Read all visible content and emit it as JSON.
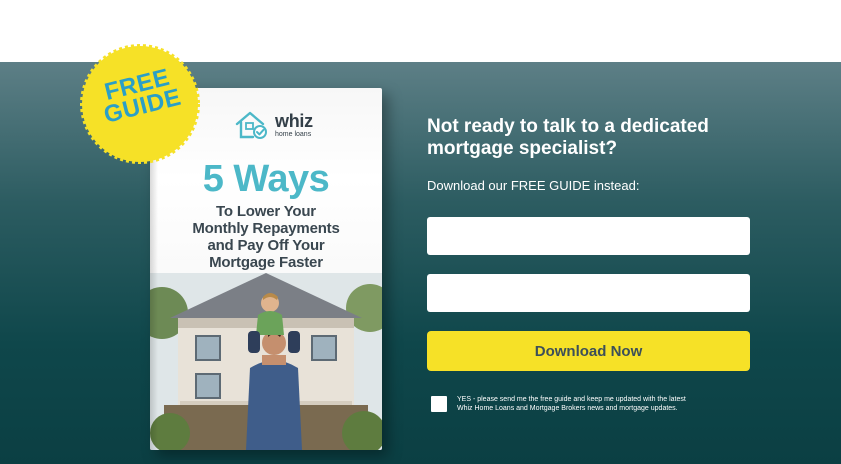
{
  "sticker": {
    "line1": "FREE",
    "line2": "GUIDE",
    "color": "#f6e127",
    "text_color": "#2b9fc7"
  },
  "book": {
    "logo_name": "whiz",
    "logo_sub": "home loans",
    "logo_icon": "house-check-icon",
    "title": "5 Ways",
    "subtitle_lines": [
      "To Lower Your",
      "Monthly Repayments",
      "and Pay Off Your",
      "Mortgage Faster"
    ],
    "title_color": "#4cb8c8"
  },
  "form": {
    "headline_line1": "Not ready to talk to a dedicated",
    "headline_line2": "mortgage specialist?",
    "subline": "Download our FREE GUIDE instead:",
    "field_1_value": "",
    "field_2_value": "",
    "button_label": "Download Now",
    "button_color": "#f6e127",
    "consent_line1": "YES - please send me the free guide and keep me updated with the latest",
    "consent_line2": "Whiz Home Loans and Mortgage Brokers news and mortgage updates."
  },
  "colors": {
    "banner_top": "#5d7f86",
    "banner_bottom": "#0b3f43"
  }
}
